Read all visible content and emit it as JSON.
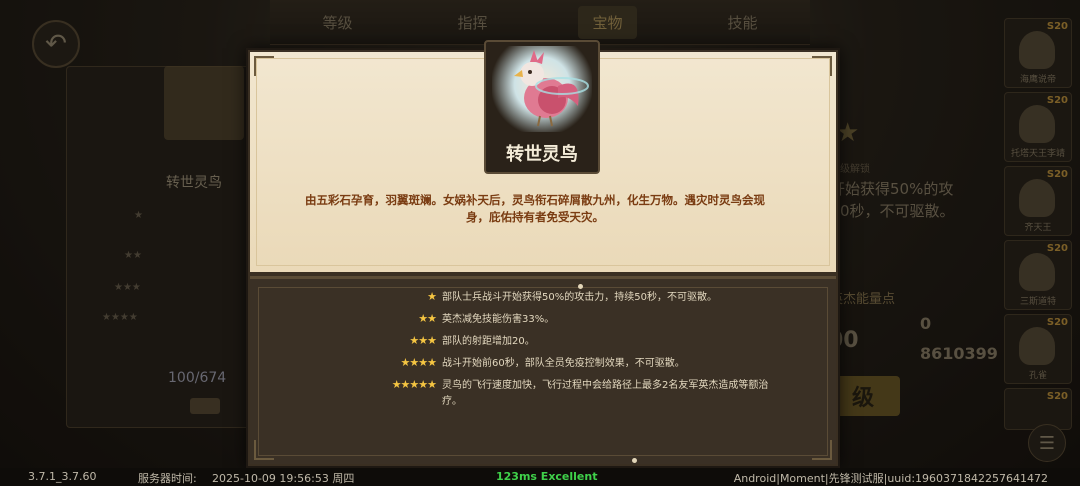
{
  "tabs": [
    "等级",
    "指挥",
    "宝物",
    "技能"
  ],
  "left_panel": {
    "name": "转世灵鸟",
    "cost": "100/674",
    "star_rows": [
      "★",
      "★★",
      "★★★",
      "★★★★"
    ]
  },
  "right_panel": {
    "label": "一级解锁",
    "text_line1": "开始获得50%的攻",
    "text_line2": "0秒，不可驱散。",
    "energy_label": "英杰能量点",
    "value_a": "00",
    "value_b_zero": "0",
    "value_b": "8610399",
    "button_label": "级"
  },
  "hero_list": [
    {
      "level": "S20",
      "name": "海鹰说帝"
    },
    {
      "level": "S20",
      "name": "托塔天王李靖"
    },
    {
      "level": "S20",
      "name": "齐天王"
    },
    {
      "level": "S20",
      "name": "三斯道特"
    },
    {
      "level": "S20",
      "name": "孔雀"
    },
    {
      "level": "S20",
      "name": ""
    }
  ],
  "modal": {
    "treasure_name": "转世灵鸟",
    "description": "由五彩石孕育，羽翼斑斓。女娲补天后，灵鸟衔石碎屑散九州，化生万物。遇灾时灵鸟会现身，庇佑持有者免受天灾。",
    "ranks": [
      {
        "stars": "★",
        "text": "部队士兵战斗开始获得50%的攻击力，持续50秒，不可驱散。"
      },
      {
        "stars": "★★",
        "text": "英杰减免技能伤害33%。"
      },
      {
        "stars": "★★★",
        "text": "部队的射距增加20。"
      },
      {
        "stars": "★★★★",
        "text": "战斗开始前60秒，部队全员免疫控制效果，不可驱散。"
      },
      {
        "stars": "★★★★★",
        "text": "灵鸟的飞行速度加快，飞行过程中会给路径上最多2名友军英杰造成等额治疗。"
      }
    ]
  },
  "statusbar": {
    "version": "3.7.1_3.7.60",
    "server_time_label": "服务器时间:",
    "server_time": "2025-10-09  19:56:53  周四",
    "ping": "123ms Excellent",
    "device": "Android|Moment|先锋测试服|uuid:1960371842257641472"
  },
  "colors": {
    "ping": "#3fd14a",
    "description": "#7a3c12",
    "star": "#f5c542"
  }
}
